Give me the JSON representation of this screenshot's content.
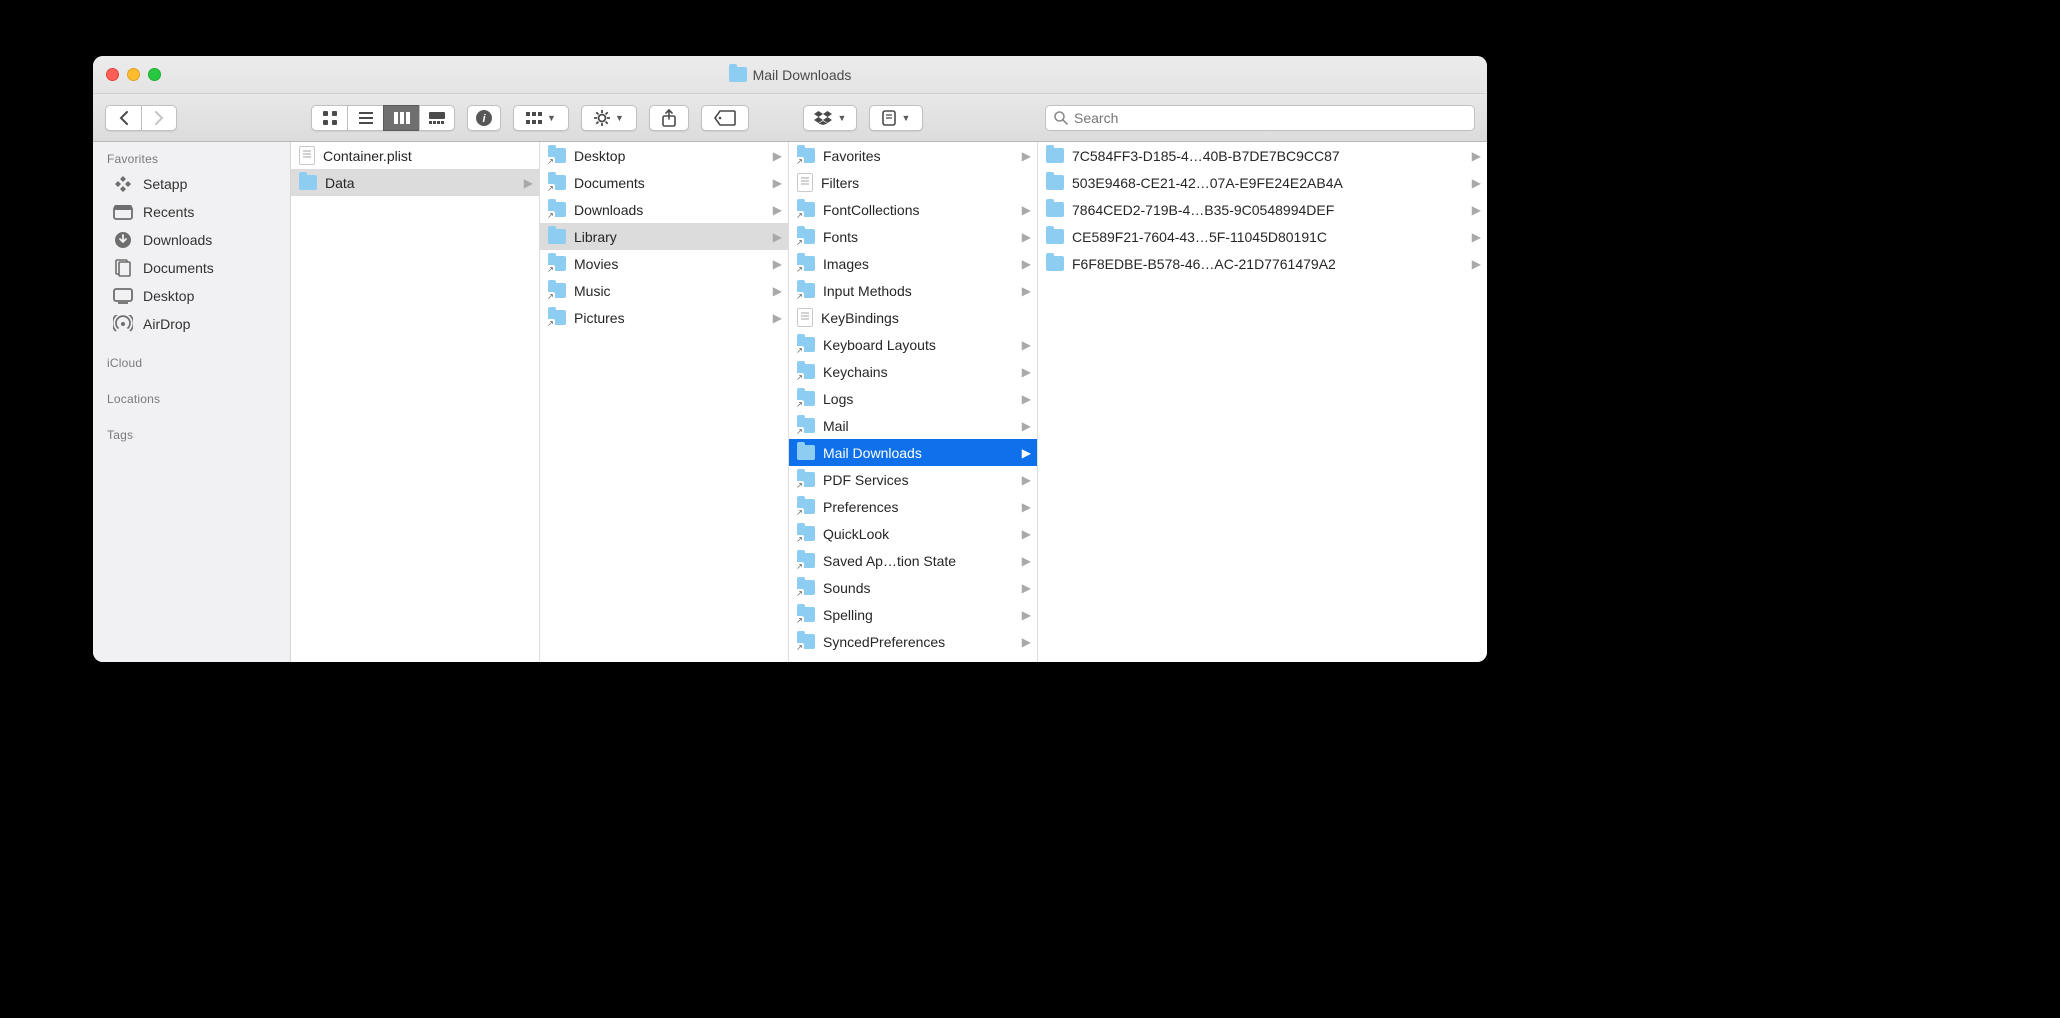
{
  "window_title": "Mail Downloads",
  "search": {
    "placeholder": "Search"
  },
  "sidebar": {
    "sections": [
      {
        "header": "Favorites",
        "items": [
          {
            "label": "Setapp",
            "icon": "setapp"
          },
          {
            "label": "Recents",
            "icon": "recents"
          },
          {
            "label": "Downloads",
            "icon": "downloads"
          },
          {
            "label": "Documents",
            "icon": "documents"
          },
          {
            "label": "Desktop",
            "icon": "desktop"
          },
          {
            "label": "AirDrop",
            "icon": "airdrop"
          }
        ]
      },
      {
        "header": "iCloud",
        "items": []
      },
      {
        "header": "Locations",
        "items": []
      },
      {
        "header": "Tags",
        "items": []
      }
    ]
  },
  "columns": [
    [
      {
        "label": "Container.plist",
        "type": "plist"
      },
      {
        "label": "Data",
        "type": "folder",
        "selected": "gray",
        "has_children": true
      }
    ],
    [
      {
        "label": "Desktop",
        "type": "folder-alias",
        "has_children": true
      },
      {
        "label": "Documents",
        "type": "folder-alias",
        "has_children": true
      },
      {
        "label": "Downloads",
        "type": "folder-alias",
        "has_children": true
      },
      {
        "label": "Library",
        "type": "folder",
        "selected": "gray",
        "has_children": true
      },
      {
        "label": "Movies",
        "type": "folder-alias",
        "has_children": true
      },
      {
        "label": "Music",
        "type": "folder-alias",
        "has_children": true
      },
      {
        "label": "Pictures",
        "type": "folder-alias",
        "has_children": true
      }
    ],
    [
      {
        "label": "Favorites",
        "type": "folder-alias",
        "has_children": true
      },
      {
        "label": "Filters",
        "type": "file"
      },
      {
        "label": "FontCollections",
        "type": "folder-alias",
        "has_children": true
      },
      {
        "label": "Fonts",
        "type": "folder-alias",
        "has_children": true
      },
      {
        "label": "Images",
        "type": "folder-alias",
        "has_children": true
      },
      {
        "label": "Input Methods",
        "type": "folder-alias",
        "has_children": true
      },
      {
        "label": "KeyBindings",
        "type": "file"
      },
      {
        "label": "Keyboard Layouts",
        "type": "folder-alias",
        "has_children": true
      },
      {
        "label": "Keychains",
        "type": "folder-alias",
        "has_children": true
      },
      {
        "label": "Logs",
        "type": "folder-alias",
        "has_children": true
      },
      {
        "label": "Mail",
        "type": "folder-alias",
        "has_children": true
      },
      {
        "label": "Mail Downloads",
        "type": "folder",
        "selected": "blue",
        "has_children": true
      },
      {
        "label": "PDF Services",
        "type": "folder-alias",
        "has_children": true
      },
      {
        "label": "Preferences",
        "type": "folder-alias",
        "has_children": true
      },
      {
        "label": "QuickLook",
        "type": "folder-alias",
        "has_children": true
      },
      {
        "label": "Saved Ap…tion State",
        "type": "folder-alias",
        "has_children": true
      },
      {
        "label": "Sounds",
        "type": "folder-alias",
        "has_children": true
      },
      {
        "label": "Spelling",
        "type": "folder-alias",
        "has_children": true
      },
      {
        "label": "SyncedPreferences",
        "type": "folder-alias",
        "has_children": true
      }
    ],
    [
      {
        "label": "7C584FF3-D185-4…40B-B7DE7BC9CC87",
        "type": "folder",
        "has_children": true
      },
      {
        "label": "503E9468-CE21-42…07A-E9FE24E2AB4A",
        "type": "folder",
        "has_children": true
      },
      {
        "label": "7864CED2-719B-4…B35-9C0548994DEF",
        "type": "folder",
        "has_children": true
      },
      {
        "label": "CE589F21-7604-43…5F-11045D80191C",
        "type": "folder",
        "has_children": true
      },
      {
        "label": "F6F8EDBE-B578-46…AC-21D7761479A2",
        "type": "folder",
        "has_children": true
      }
    ]
  ]
}
